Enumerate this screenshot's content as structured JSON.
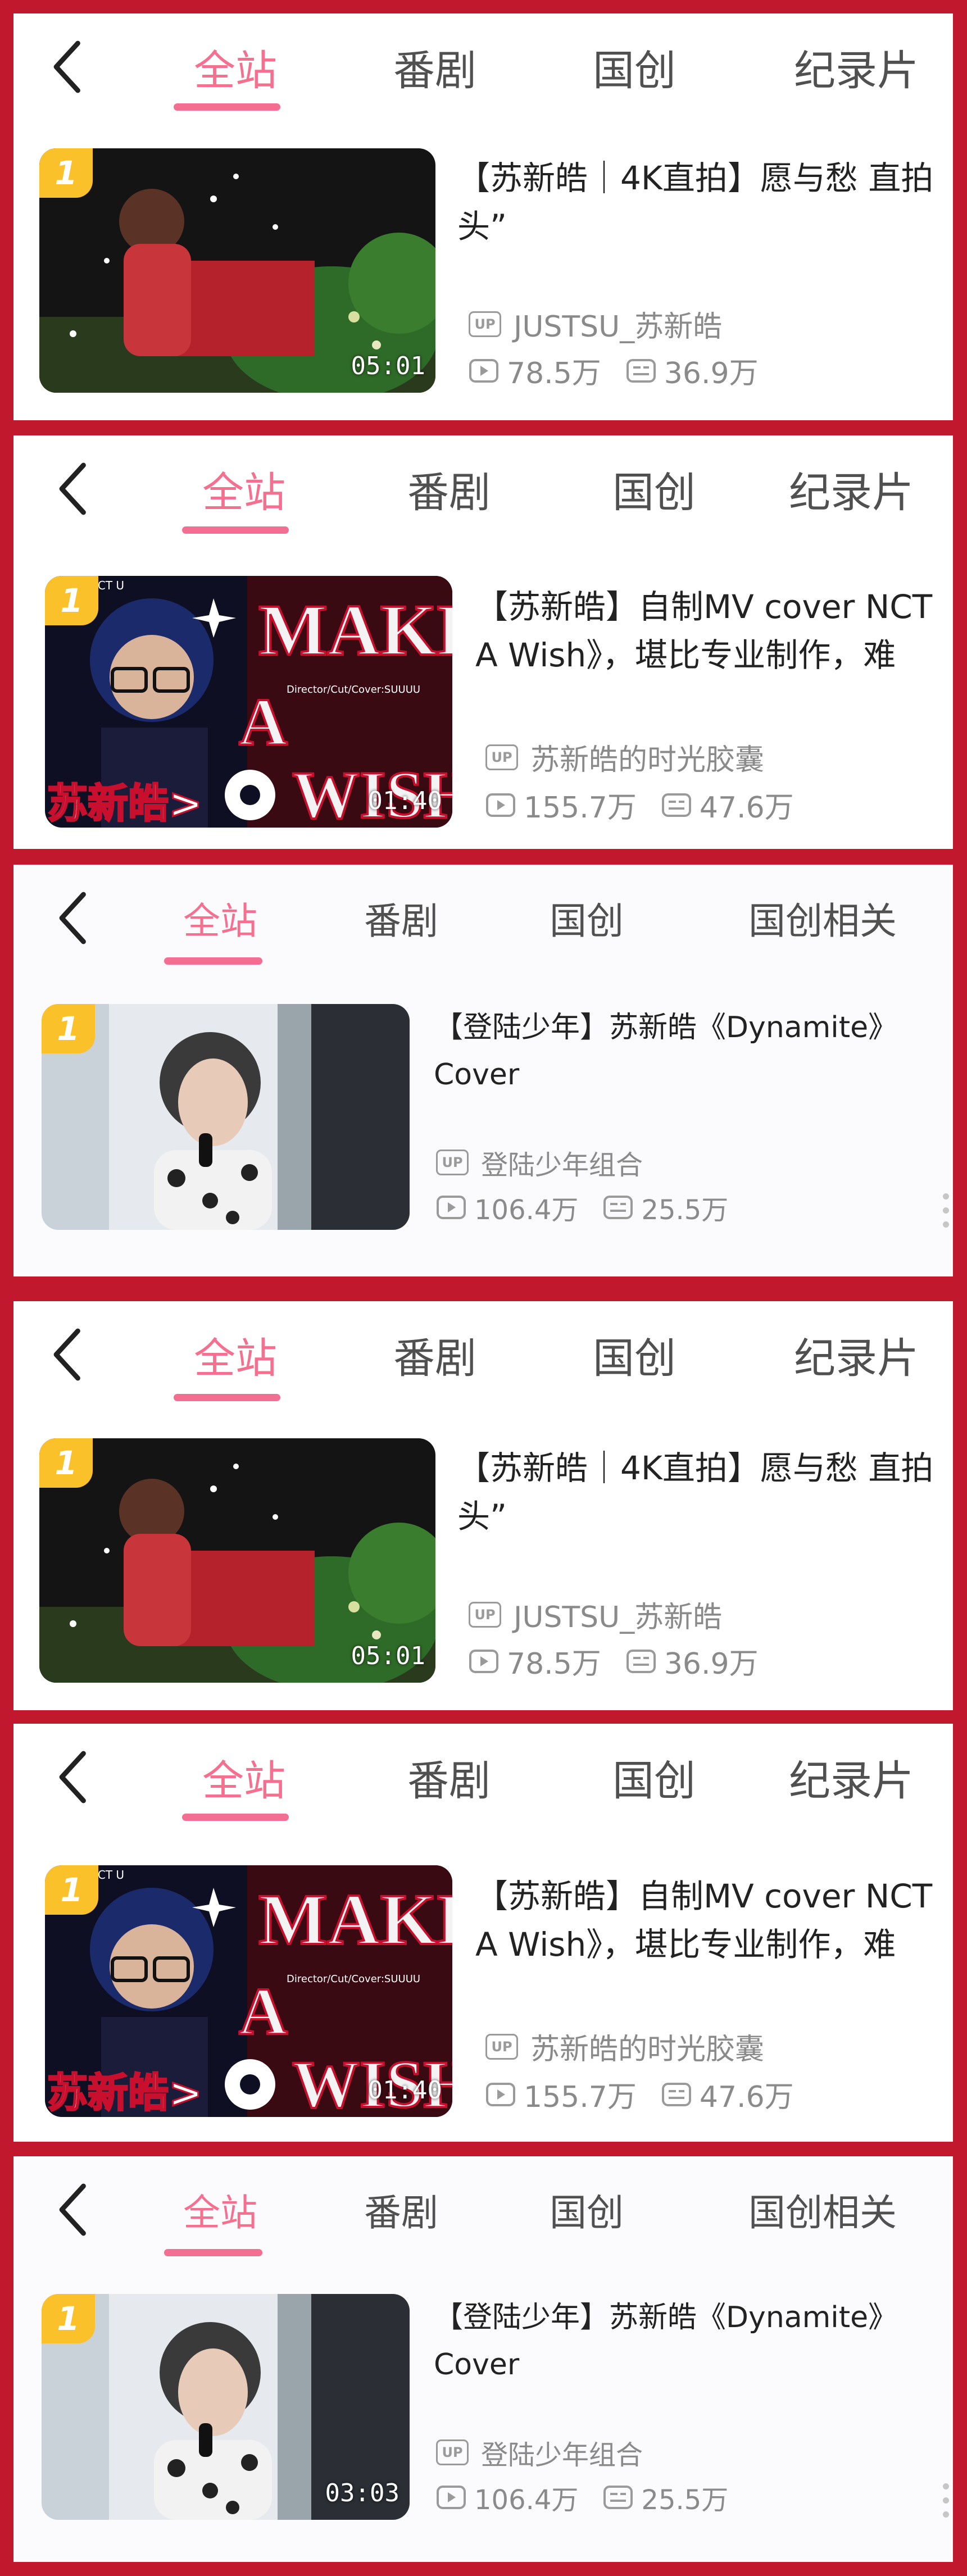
{
  "tabs_a": {
    "t1": "全站",
    "t2": "番剧",
    "t3": "国创",
    "t4": "纪录片"
  },
  "tabs_b": {
    "t1": "全站",
    "t2": "番剧",
    "t3": "国创",
    "t4": "国创相关"
  },
  "videos": {
    "v1": {
      "rank": "1",
      "title_line1": "【苏新皓｜4K直拍】愿与愁  直拍",
      "title_line2": "头”",
      "uploader": "JUSTSU_苏新皓",
      "plays": "78.5万",
      "danmaku": "36.9万",
      "duration": "05:01"
    },
    "v2": {
      "rank": "1",
      "title_line1": "【苏新皓】自制MV  cover  NCT",
      "title_line2": "A  Wish》，堪比专业制作，难",
      "uploader": "苏新皓的时光胶囊",
      "plays": "155.7万",
      "danmaku": "47.6万",
      "duration": "01:40",
      "thumb_text_make": "MAKE",
      "thumb_text_a": "A",
      "thumb_text_wish": "WISH",
      "thumb_text_by": "BY:NCT U",
      "thumb_text_credit": "Director/Cut/Cover:SUUUU",
      "thumb_text_name": "苏新皓>"
    },
    "v3": {
      "rank": "1",
      "title_line1": "【登陆少年】苏新皓《Dynamite》",
      "title_line2": "Cover",
      "uploader": "登陆少年组合",
      "plays": "106.4万",
      "danmaku": "25.5万",
      "duration": "03:03"
    }
  },
  "labels": {
    "up_badge": "UP"
  },
  "colors": {
    "accent_pink": "#f26f91",
    "frame_red": "#c1182d",
    "badge_yellow": "#fbc12b"
  }
}
